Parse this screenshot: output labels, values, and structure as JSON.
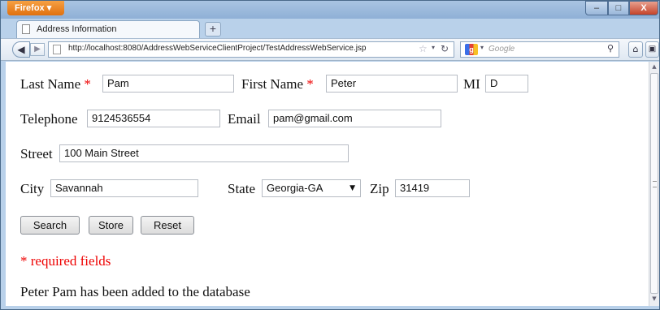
{
  "browser": {
    "app_button": "Firefox",
    "tab_title": "Address Information",
    "new_tab": "+",
    "url": "http://localhost:8080/AddressWebServiceClientProject/TestAddressWebService.jsp",
    "search_placeholder": "Google",
    "search_engine": "g",
    "controls": {
      "minimize": "–",
      "maximize": "□",
      "close": "X"
    }
  },
  "form": {
    "last_name_label": "Last Name",
    "last_name_value": "Pam",
    "first_name_label": "First Name",
    "first_name_value": "Peter",
    "mi_label": "MI",
    "mi_value": "D",
    "required_marker": "*",
    "telephone_label": "Telephone",
    "telephone_value": "9124536554",
    "email_label": "Email",
    "email_value": "pam@gmail.com",
    "street_label": "Street",
    "street_value": "100 Main Street",
    "city_label": "City",
    "city_value": "Savannah",
    "state_label": "State",
    "state_value": "Georgia-GA",
    "zip_label": "Zip",
    "zip_value": "31419"
  },
  "buttons": {
    "search": "Search",
    "store": "Store",
    "reset": "Reset"
  },
  "required_note": "* required fields",
  "status_message": "Peter Pam has been added to the database"
}
